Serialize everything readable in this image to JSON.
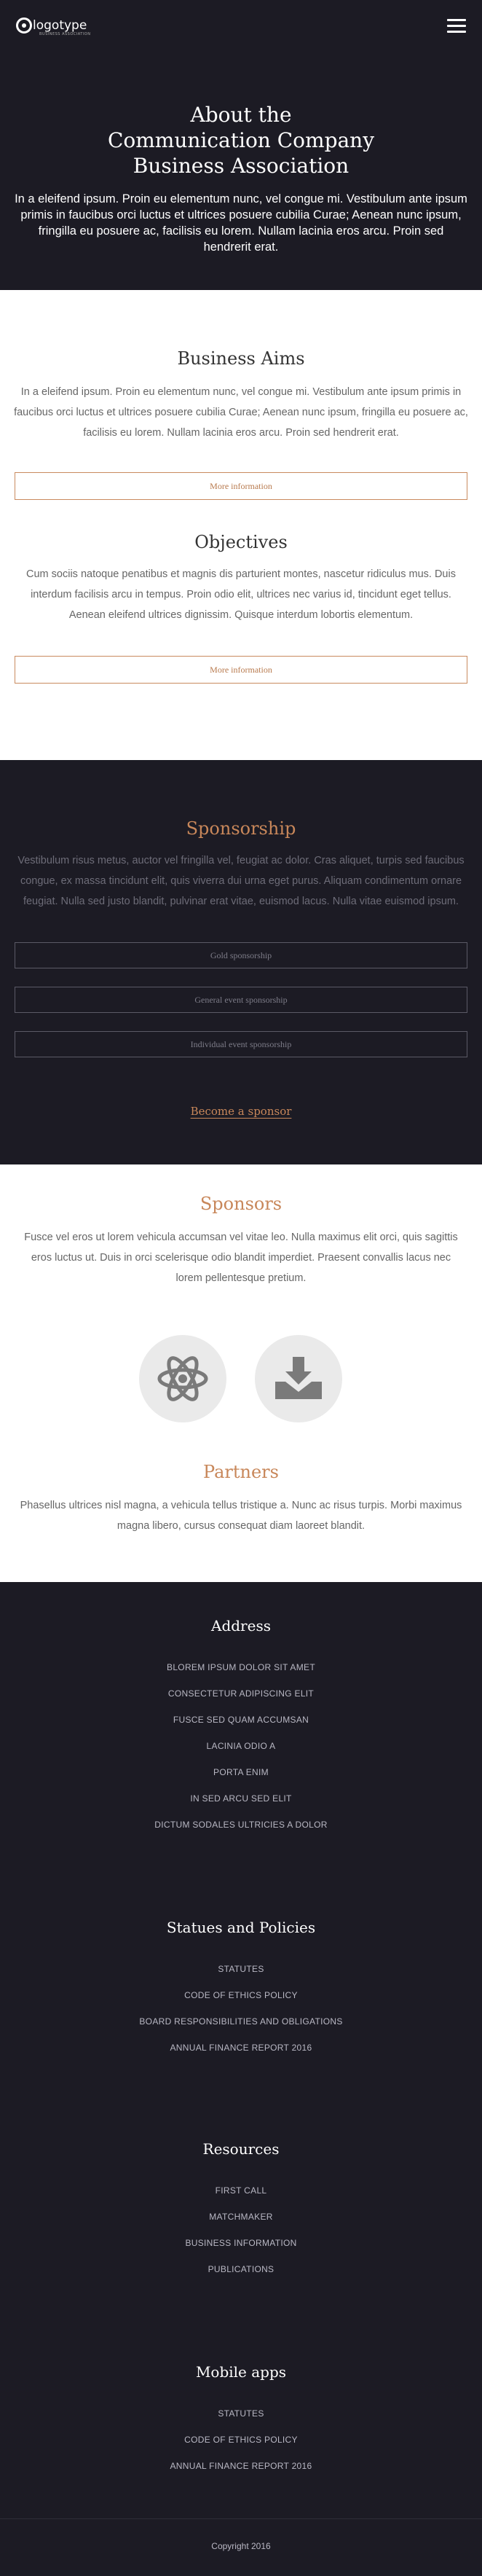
{
  "header": {
    "logo_text": "logotype",
    "logo_sub": "BUSINESS ASSOCIATION",
    "title_lines": [
      "About the",
      "Communication Company",
      "Business Association"
    ],
    "intro": "In a eleifend ipsum. Proin eu elementum nunc, vel congue mi. Vestibulum ante ipsum primis in faucibus orci luctus et ultrices posuere cubilia Curae; Aenean nunc ipsum, fringilla eu posuere ac, facilisis eu lorem. Nullam lacinia eros arcu. Proin sed hendrerit erat."
  },
  "aims": {
    "title": "Business Aims",
    "text": "In a eleifend ipsum. Proin eu elementum nunc, vel congue mi. Vestibulum ante ipsum primis in faucibus orci luctus et ultrices posuere cubilia Curae; Aenean nunc ipsum, fringilla eu posuere ac, facilisis eu lorem. Nullam lacinia eros arcu. Proin sed hendrerit erat.",
    "button": "More information"
  },
  "objectives": {
    "title": "Objectives",
    "text": "Cum sociis natoque penatibus et magnis dis parturient montes, nascetur ridiculus mus. Duis interdum facilisis arcu in tempus. Proin odio elit, ultrices nec varius id, tincidunt eget tellus. Aenean eleifend ultrices dignissim. Quisque interdum lobortis elementum.",
    "button": "More information"
  },
  "sponsorship": {
    "title": "Sponsorship",
    "text": "Vestibulum risus metus, auctor vel fringilla vel, feugiat ac dolor. Cras aliquet, turpis sed faucibus congue, ex massa tincidunt elit, quis viverra dui urna eget purus. Aliquam condimentum ornare feugiat. Nulla sed justo blandit, pulvinar erat vitae, euismod lacus. Nulla vitae euismod ipsum.",
    "buttons": [
      "Gold sponsorship",
      "General event sponsorship",
      "Individual event sponsorship"
    ],
    "cta": "Become a sponsor"
  },
  "sponsors": {
    "title": "Sponsors",
    "text": "Fusce vel eros ut lorem vehicula accumsan vel vitae leo. Nulla maximus elit orci, quis sagittis eros luctus ut. Duis in orci scelerisque odio blandit imperdiet. Praesent convallis lacus nec lorem pellentesque pretium.",
    "logos": [
      "atom-icon",
      "download-tray-icon"
    ]
  },
  "partners": {
    "title": "Partners",
    "text": "Phasellus ultrices nisl magna, a vehicula tellus tristique a. Nunc ac risus turpis. Morbi maximus magna libero, cursus consequat diam laoreet blandit."
  },
  "footer": {
    "address": {
      "title": "Address",
      "lines": [
        "BLOREM IPSUM DOLOR SIT AMET",
        "CONSECTETUR ADIPISCING ELIT",
        "FUSCE SED QUAM ACCUMSAN",
        "LACINIA ODIO A",
        "PORTA ENIM",
        "IN SED ARCU SED ELIT",
        "DICTUM SODALES ULTRICIES A DOLOR"
      ]
    },
    "statues": {
      "title": "Statues and Policies",
      "links": [
        "STATUTES",
        "CODE OF ETHICS POLICY",
        "BOARD RESPONSIBILITIES AND OBLIGATIONS",
        "ANNUAL FINANCE REPORT 2016"
      ]
    },
    "resources": {
      "title": "Resources",
      "links": [
        "FIRST CALL",
        "MATCHMAKER",
        "BUSINESS INFORMATION",
        "PUBLICATIONS"
      ]
    },
    "mobile": {
      "title": "Mobile apps",
      "links": [
        "STATUTES",
        "CODE OF ETHICS POLICY",
        "ANNUAL FINANCE REPORT 2016"
      ]
    },
    "copyright": "Copyright 2016"
  }
}
